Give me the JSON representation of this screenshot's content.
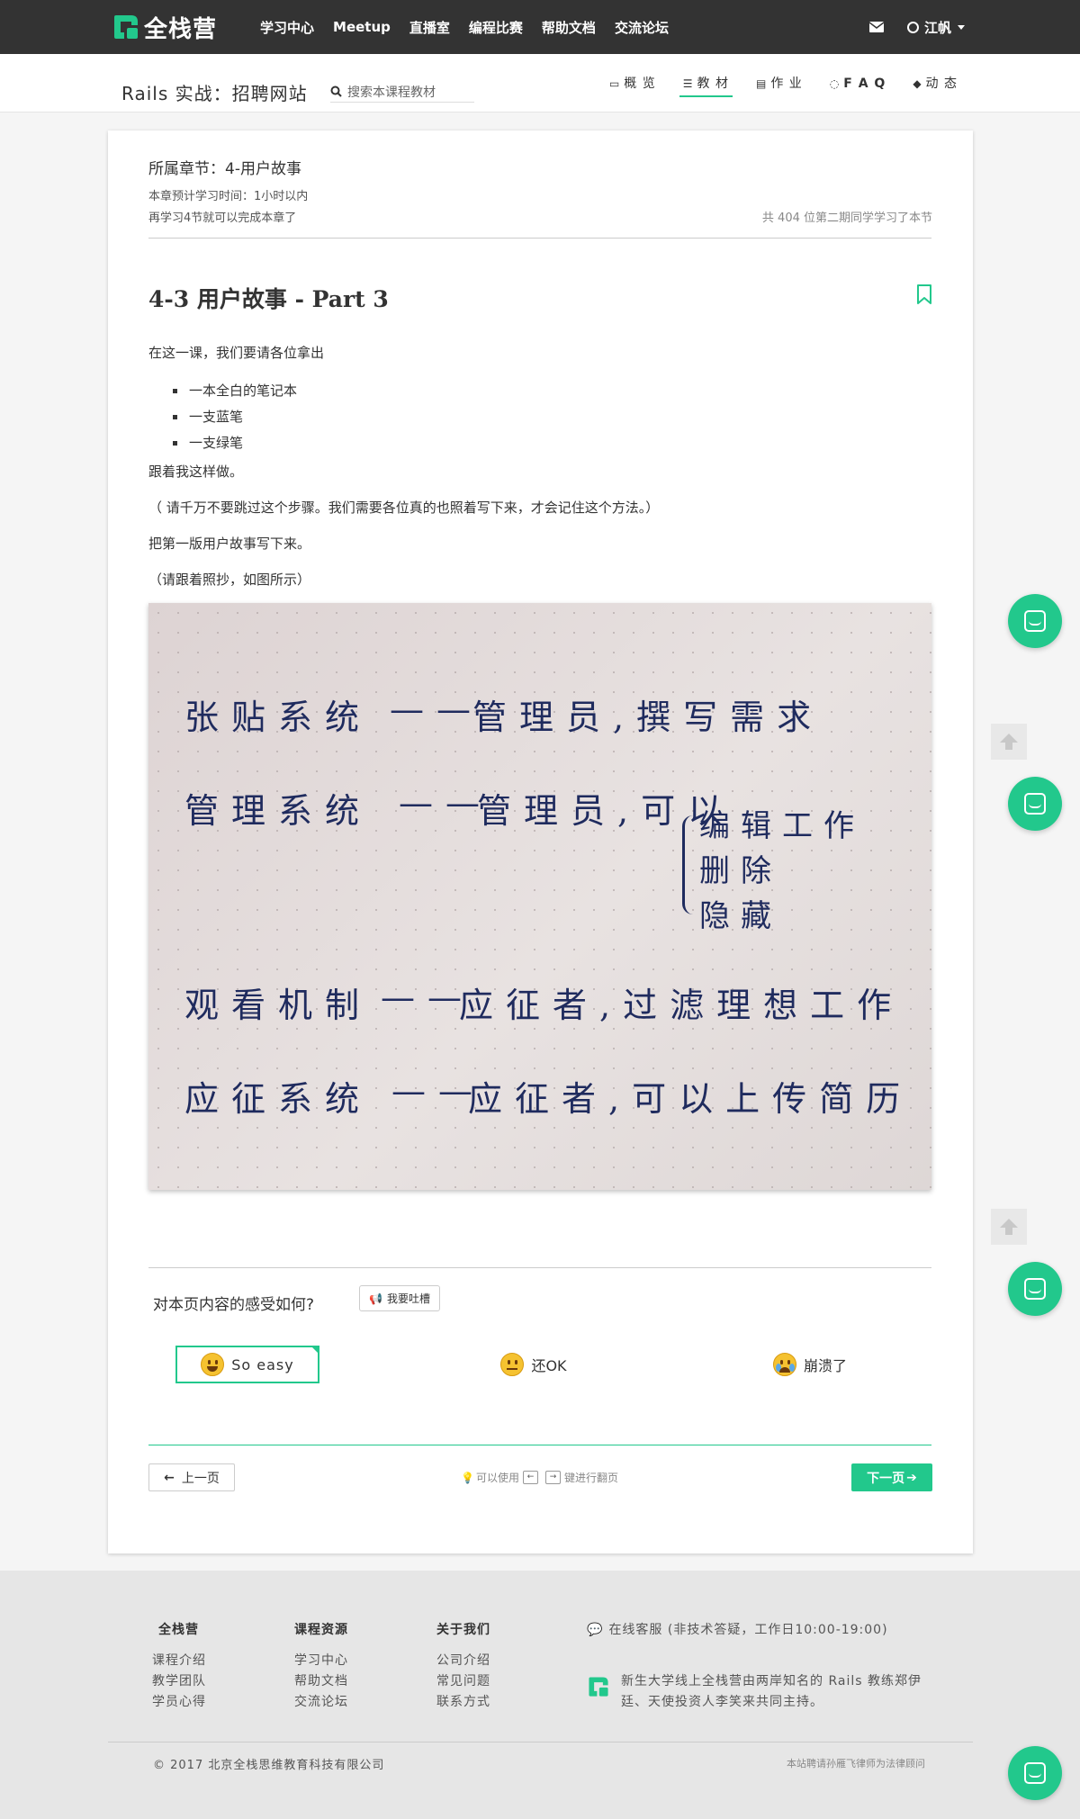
{
  "nav": {
    "logo_text": "全栈营",
    "links": [
      "学习中心",
      "Meetup",
      "直播室",
      "编程比赛",
      "帮助文档",
      "交流论坛"
    ],
    "user_name": "江帆"
  },
  "course": {
    "title": "Rails 实战：招聘网站",
    "search_placeholder": "搜索本课程教材",
    "tabs": [
      {
        "label": "概 览",
        "icon": "monitor-icon"
      },
      {
        "label": "教 材",
        "icon": "list-icon",
        "active": true
      },
      {
        "label": "作 业",
        "icon": "document-icon"
      },
      {
        "label": "F A Q",
        "icon": "chat-icon"
      },
      {
        "label": "动 态",
        "icon": "tag-icon"
      }
    ]
  },
  "section": {
    "chapter": "所属章节：4-用户故事",
    "estimate": "本章预计学习时间：1小时以内",
    "remaining": "再学习4节就可以完成本章了",
    "count": "共 404 位第二期同学学习了本节"
  },
  "lesson": {
    "title": "4-3 用户故事 - Part 3",
    "intro": "在这一课，我们要请各位拿出",
    "items": [
      "一本全白的笔记本",
      "一支蓝笔",
      "一支绿笔"
    ],
    "follow": "跟着我这样做。",
    "warning": "（ 请千万不要跳过这个步骤。我们需要各位真的也照着写下来，才会记住这个方法。）",
    "write": "把第一版用户故事写下来。",
    "copy_note": "（请跟着照抄，如图所示）"
  },
  "handwriting": {
    "line1_left": "张贴系统",
    "line1_dash": "——",
    "line1_right": "管理员,撰写需求",
    "line2_left": "管理系统",
    "line2_dash": "——",
    "line2_right": "管理员,可以",
    "line2_opt1": "编辑工作",
    "line2_opt2": "删除",
    "line2_opt3": "隐藏",
    "line3_left": "观看机制",
    "line3_dash": "——",
    "line3_right": "应征者,过滤理想工作",
    "line4_left": "应征系统",
    "line4_dash": "——",
    "line4_right": "应征者,可以上传简历"
  },
  "feedback": {
    "question": "对本页内容的感受如何?",
    "rant_label": "我要吐槽",
    "options": [
      "So easy",
      "还OK",
      "崩溃了"
    ]
  },
  "pager": {
    "prev": "上一页",
    "hint_pre": "可以使用",
    "key_left": "←",
    "key_right": "→",
    "hint_post": "键进行翻页",
    "next": "下一页"
  },
  "footer": {
    "col1_title": "全栈营",
    "col1_items": [
      "课程介绍",
      "教学团队",
      "学员心得"
    ],
    "col2_title": "课程资源",
    "col2_items": [
      "学习中心",
      "帮助文档",
      "交流论坛"
    ],
    "col3_title": "关于我们",
    "col3_items": [
      "公司介绍",
      "常见问题",
      "联系方式"
    ],
    "service": "在线客服 (非技术答疑，工作日10:00-19:00)",
    "about": "新生大学线上全栈营由两岸知名的 Rails 教练郑伊廷、天使投资人李笑来共同主持。",
    "copyright": "© 2017 北京全栈思维教育科技有限公司",
    "law": "本站聘请孙雁飞律师为法律顾问"
  },
  "colors": {
    "accent": "#22c88c",
    "nav_bg": "#333333"
  }
}
